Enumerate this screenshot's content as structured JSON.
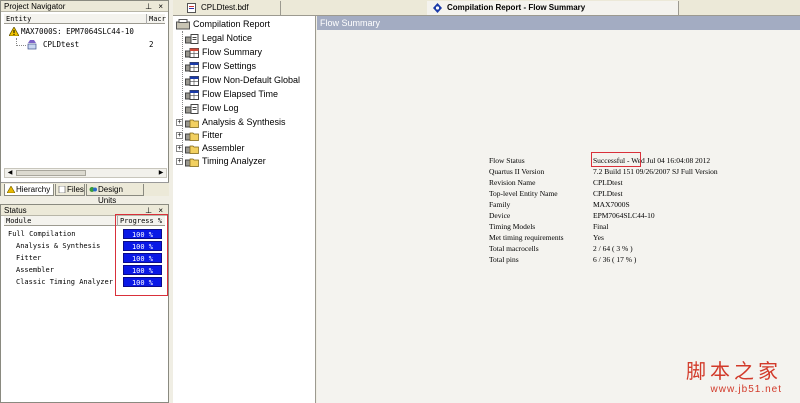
{
  "navigator": {
    "title": "Project Navigator",
    "controls": "⊥ ×",
    "col_entity": "Entity",
    "col_macro": "Macr",
    "rows": [
      {
        "label": "MAX7000S: EPM7064SLC44-10",
        "value": ""
      },
      {
        "label": "CPLDtest",
        "value": "2"
      }
    ],
    "tabs": [
      "Hierarchy",
      "Files",
      "Design Units"
    ]
  },
  "status": {
    "title": "Status",
    "controls": "⊥ ×",
    "col_module": "Module",
    "col_progress": "Progress %",
    "rows": [
      {
        "label": "Full Compilation",
        "value": "100 %"
      },
      {
        "label": "Analysis & Synthesis",
        "value": "100 %"
      },
      {
        "label": "Fitter",
        "value": "100 %"
      },
      {
        "label": "Assembler",
        "value": "100 %"
      },
      {
        "label": "Classic Timing Analyzer",
        "value": "100 %"
      }
    ]
  },
  "tabs": {
    "bdf": "CPLDtest.bdf",
    "report": "Compilation Report - Flow Summary"
  },
  "tree": {
    "root": "Compilation Report",
    "items": [
      "Legal Notice",
      "Flow Summary",
      "Flow Settings",
      "Flow Non-Default Global",
      "Flow Elapsed Time",
      "Flow Log"
    ],
    "folders": [
      "Analysis & Synthesis",
      "Fitter",
      "Assembler",
      "Timing Analyzer"
    ]
  },
  "summary": {
    "title": "Flow Summary",
    "rows": [
      {
        "key": "Flow Status",
        "value": "Successful - Wed Jul 04 16:04:08 2012"
      },
      {
        "key": "Quartus II Version",
        "value": "7.2 Build 151 09/26/2007 SJ Full Version"
      },
      {
        "key": "Revision Name",
        "value": "CPLDtest"
      },
      {
        "key": "Top-level Entity Name",
        "value": "CPLDtest"
      },
      {
        "key": "Family",
        "value": "MAX7000S"
      },
      {
        "key": "Device",
        "value": "EPM7064SLC44-10"
      },
      {
        "key": "Timing Models",
        "value": "Final"
      },
      {
        "key": "Met timing requirements",
        "value": "Yes"
      },
      {
        "key": "Total macrocells",
        "value": "2 / 64 ( 3 % )"
      },
      {
        "key": "Total pins",
        "value": "6 / 36 ( 17 % )"
      }
    ]
  },
  "watermark": {
    "text": "脚本之家",
    "url": "www.jb51.net"
  },
  "colors": {
    "progress_bar": "#0a18e6",
    "highlight_box": "#d9303a",
    "summary_header": "#a3acc2",
    "watermark": "#d23a2a"
  }
}
